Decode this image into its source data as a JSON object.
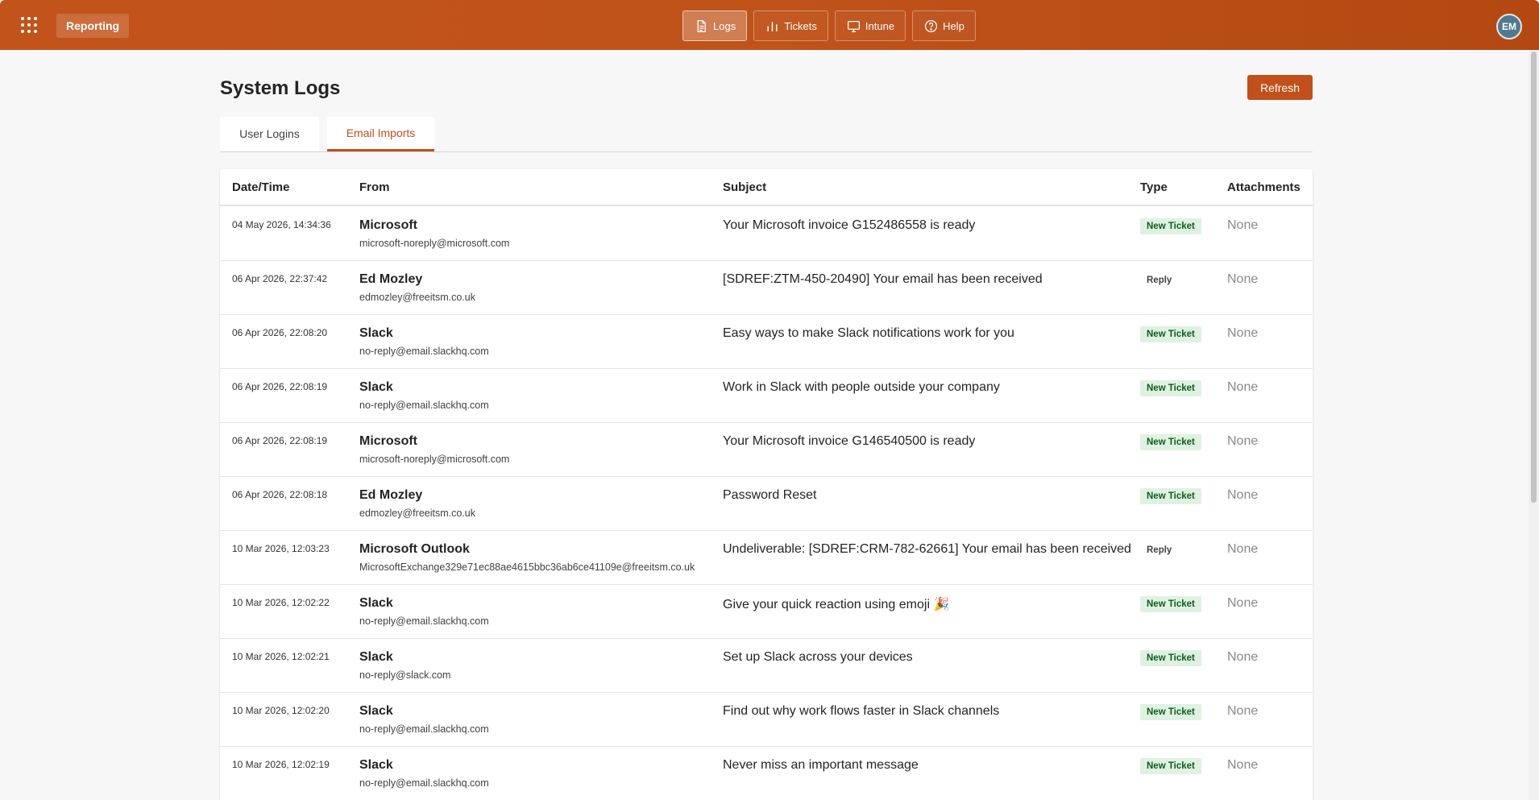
{
  "header": {
    "app_title": "Reporting",
    "nav": [
      {
        "label": "Logs",
        "icon": "document-icon",
        "active": true
      },
      {
        "label": "Tickets",
        "icon": "bar-chart-icon",
        "active": false
      },
      {
        "label": "Intune",
        "icon": "monitor-icon",
        "active": false
      },
      {
        "label": "Help",
        "icon": "help-circle-icon",
        "active": false
      }
    ],
    "avatar_initials": "EM"
  },
  "page": {
    "title": "System Logs",
    "refresh_label": "Refresh",
    "tabs": [
      {
        "label": "User Logins",
        "active": false
      },
      {
        "label": "Email Imports",
        "active": true
      }
    ]
  },
  "table": {
    "columns": [
      "Date/Time",
      "From",
      "Subject",
      "Type",
      "Attachments"
    ],
    "rows": [
      {
        "datetime": "04 May 2026, 14:34:36",
        "name": "Microsoft",
        "email": "microsoft-noreply@microsoft.com",
        "subject": "Your Microsoft invoice G152486558 is ready",
        "type": "New Ticket",
        "attachments": "None"
      },
      {
        "datetime": "06 Apr 2026, 22:37:42",
        "name": "Ed Mozley",
        "email": "edmozley@freeitsm.co.uk",
        "subject": "[SDREF:ZTM-450-20490] Your email has been received",
        "type": "Reply",
        "attachments": "None"
      },
      {
        "datetime": "06 Apr 2026, 22:08:20",
        "name": "Slack",
        "email": "no-reply@email.slackhq.com",
        "subject": "Easy ways to make Slack notifications work for you",
        "type": "New Ticket",
        "attachments": "None"
      },
      {
        "datetime": "06 Apr 2026, 22:08:19",
        "name": "Slack",
        "email": "no-reply@email.slackhq.com",
        "subject": "Work in Slack with people outside your company",
        "type": "New Ticket",
        "attachments": "None"
      },
      {
        "datetime": "06 Apr 2026, 22:08:19",
        "name": "Microsoft",
        "email": "microsoft-noreply@microsoft.com",
        "subject": "Your Microsoft invoice G146540500 is ready",
        "type": "New Ticket",
        "attachments": "None"
      },
      {
        "datetime": "06 Apr 2026, 22:08:18",
        "name": "Ed Mozley",
        "email": "edmozley@freeitsm.co.uk",
        "subject": "Password Reset",
        "type": "New Ticket",
        "attachments": "None"
      },
      {
        "datetime": "10 Mar 2026, 12:03:23",
        "name": "Microsoft Outlook",
        "email": "MicrosoftExchange329e71ec88ae4615bbc36ab6ce41109e@freeitsm.co.uk",
        "subject": "Undeliverable: [SDREF:CRM-782-62661] Your email has been received",
        "type": "Reply",
        "attachments": "None"
      },
      {
        "datetime": "10 Mar 2026, 12:02:22",
        "name": "Slack",
        "email": "no-reply@email.slackhq.com",
        "subject": "Give your quick reaction using emoji 🎉",
        "type": "New Ticket",
        "attachments": "None"
      },
      {
        "datetime": "10 Mar 2026, 12:02:21",
        "name": "Slack",
        "email": "no-reply@slack.com",
        "subject": "Set up Slack across your devices",
        "type": "New Ticket",
        "attachments": "None"
      },
      {
        "datetime": "10 Mar 2026, 12:02:20",
        "name": "Slack",
        "email": "no-reply@email.slackhq.com",
        "subject": "Find out why work flows faster in Slack channels",
        "type": "New Ticket",
        "attachments": "None"
      },
      {
        "datetime": "10 Mar 2026, 12:02:19",
        "name": "Slack",
        "email": "no-reply@email.slackhq.com",
        "subject": "Never miss an important message",
        "type": "New Ticket",
        "attachments": "None"
      }
    ]
  },
  "colors": {
    "accent": "#c2501a",
    "badge_new_bg": "#dff2e1",
    "badge_new_text": "#0e5c1e"
  }
}
